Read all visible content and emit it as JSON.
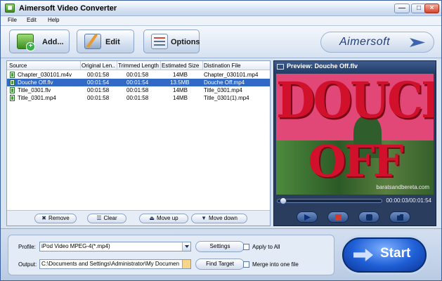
{
  "window": {
    "title": "Aimersoft Video Converter"
  },
  "window_controls": {
    "minimize": "—",
    "maximize": "□",
    "close": "×"
  },
  "menu": [
    "File",
    "Edit",
    "Help"
  ],
  "toolbar": {
    "add_label": "Add...",
    "edit_label": "Edit",
    "options_label": "Options"
  },
  "logo": {
    "text": "Aimersoft"
  },
  "file_list": {
    "columns": [
      "Source",
      "Original Len...",
      "Trimmed Length",
      "Estimated Size",
      "Distination File"
    ],
    "rows": [
      {
        "source": "Chapter_030101.m4v",
        "original": "00:01:58",
        "trimmed": "00:01:58",
        "size": "14MB",
        "dest": "Chapter_030101.mp4"
      },
      {
        "source": "Douche Off.flv",
        "original": "00:01:54",
        "trimmed": "00:01:54",
        "size": "13.5MB",
        "dest": "Douche Off.mp4"
      },
      {
        "source": "Title_0301.flv",
        "original": "00:01:58",
        "trimmed": "00:01:58",
        "size": "14MB",
        "dest": "Title_0301.mp4"
      },
      {
        "source": "Title_0301.mp4",
        "original": "00:01:58",
        "trimmed": "00:01:58",
        "size": "14MB",
        "dest": "Title_0301(1).mp4"
      }
    ],
    "selected_index": 1
  },
  "list_buttons": {
    "remove": "Remove",
    "clear": "Clear",
    "move_up": "Move up",
    "move_down": "Move down"
  },
  "preview": {
    "title": "Preview: Douche Off.flv",
    "video_text_line1": "DOUCHE",
    "video_text_line2": "OFF",
    "watermark": "baratsandbereta.com",
    "timecode": "00:00:03/00:01:54",
    "progress": 0.03
  },
  "settings": {
    "profile_label": "Profile:",
    "profile_value": "iPod Video MPEG-4(*.mp4)",
    "output_label": "Output:",
    "output_value": "C:\\Documents and Settings\\Administrator\\My Documen",
    "settings_button": "Settings",
    "find_target_button": "Find Target",
    "apply_to_all": "Apply to All",
    "merge": "Merge into one file"
  },
  "start_button": {
    "label": "Start"
  }
}
